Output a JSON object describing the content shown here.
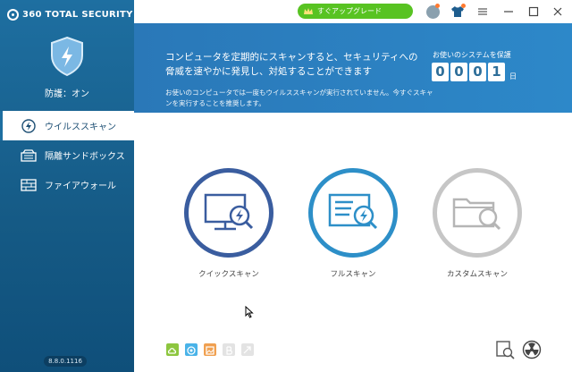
{
  "app": {
    "name": "360 TOTAL SECURITY",
    "version": "8.8.0.1116"
  },
  "sidebar": {
    "status": "防護：オン",
    "items": [
      {
        "label": "ウイルススキャン",
        "icon": "lightning-icon",
        "active": true
      },
      {
        "label": "隔離サンドボックス",
        "icon": "sandbox-icon",
        "active": false
      },
      {
        "label": "ファイアウォール",
        "icon": "firewall-icon",
        "active": false
      }
    ]
  },
  "titlebar": {
    "upgrade_label": "すぐアップグレード"
  },
  "banner": {
    "headline": "コンピュータを定期的にスキャンすると、セキュリティへの脅威を速やかに発見し、対処することができます",
    "subtext": "お使いのコンピュータでは一度もウイルススキャンが実行されていません。今すぐスキャンを実行することを推奨します。",
    "days_label": "お使いのシステムを保護",
    "days_digits": [
      "0",
      "0",
      "0",
      "1"
    ],
    "days_unit": "日"
  },
  "scans": [
    {
      "label": "クイックスキャン",
      "color": "#3a5d9f"
    },
    {
      "label": "フルスキャン",
      "color": "#2d8fc8"
    },
    {
      "label": "カスタムスキャン",
      "color": "#c6c6c6"
    }
  ],
  "colors": {
    "sidebar": "#1e6fa1",
    "banner": "#2a7fc0",
    "accent_green": "#58c322"
  }
}
